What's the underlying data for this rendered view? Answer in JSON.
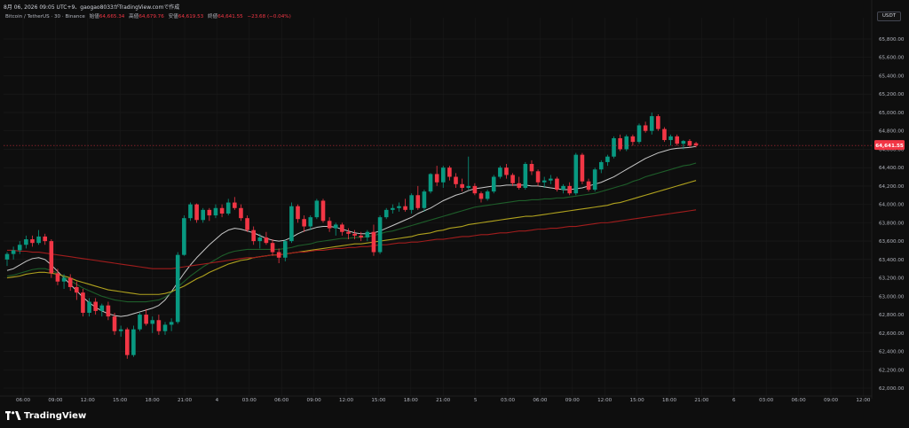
{
  "header": {
    "title": "8月 06, 2026 09:05 UTC+9、gaogao8033がTradingView.comで作成"
  },
  "legend": {
    "symbol": "Bitcoin / TetherUS · 30 · Binance",
    "open_label": "始値",
    "open_value": "64,665.34",
    "high_label": "高値",
    "high_value": "64,679.76",
    "low_label": "安値",
    "low_value": "64,619.53",
    "close_label": "終値",
    "close_value": "64,641.55",
    "change": "−23.68 (−0.04%)"
  },
  "price_axis": {
    "currency": "USDT",
    "last_price_label": "64,641.55"
  },
  "branding": {
    "name": "TradingView"
  },
  "colors": {
    "background": "#0e0e0e",
    "up": "#089981",
    "down": "#f23645",
    "ma_fast": "#c8c8c8",
    "ma_green": "#1e5e2a",
    "ma_yellow": "#b0a21e",
    "ma_red": "#a11d1d"
  },
  "chart_data": {
    "type": "candlestick",
    "interval": "30",
    "ylim": [
      62000,
      66000
    ],
    "y_ticks": [
      62000,
      62200,
      62400,
      62600,
      62800,
      63000,
      63200,
      63400,
      63600,
      63800,
      64000,
      64200,
      64400,
      64600,
      64800,
      65000,
      65200,
      65400,
      65600,
      65800
    ],
    "y_tick_labels": [
      "62,000.00",
      "62,200.00",
      "62,400.00",
      "62,600.00",
      "62,800.00",
      "63,000.00",
      "63,200.00",
      "63,400.00",
      "63,600.00",
      "63,800.00",
      "64,000.00",
      "64,200.00",
      "64,400.00",
      "64,600.00",
      "64,800.00",
      "65,000.00",
      "65,200.00",
      "65,400.00",
      "65,600.00",
      "65,800.00"
    ],
    "x_labels": [
      "06:00",
      "09:00",
      "12:00",
      "15:00",
      "18:00",
      "21:00",
      "4",
      "03:00",
      "06:00",
      "09:00",
      "12:00",
      "15:00",
      "18:00",
      "21:00",
      "5",
      "03:00",
      "06:00",
      "09:00",
      "12:00",
      "15:00",
      "18:00",
      "21:00",
      "6",
      "03:00",
      "06:00",
      "09:00",
      "12:00"
    ],
    "last_price": 64641.55,
    "candles": [
      [
        63400,
        63480,
        63330,
        63460
      ],
      [
        63460,
        63540,
        63400,
        63500
      ],
      [
        63500,
        63600,
        63460,
        63560
      ],
      [
        63560,
        63660,
        63520,
        63620
      ],
      [
        63620,
        63660,
        63540,
        63580
      ],
      [
        63580,
        63720,
        63560,
        63650
      ],
      [
        63650,
        63680,
        63560,
        63600
      ],
      [
        63600,
        63620,
        63200,
        63250
      ],
      [
        63250,
        63300,
        63120,
        63160
      ],
      [
        63160,
        63240,
        63080,
        63200
      ],
      [
        63200,
        63240,
        63060,
        63100
      ],
      [
        63100,
        63160,
        62960,
        63040
      ],
      [
        63040,
        63080,
        62780,
        62820
      ],
      [
        62820,
        62980,
        62780,
        62940
      ],
      [
        62940,
        62980,
        62800,
        62840
      ],
      [
        62840,
        62920,
        62780,
        62900
      ],
      [
        62900,
        62940,
        62740,
        62780
      ],
      [
        62780,
        62820,
        62580,
        62620
      ],
      [
        62620,
        62680,
        62560,
        62640
      ],
      [
        62640,
        62660,
        62320,
        62360
      ],
      [
        62360,
        62680,
        62340,
        62640
      ],
      [
        62640,
        62820,
        62620,
        62800
      ],
      [
        62800,
        62860,
        62680,
        62700
      ],
      [
        62700,
        62780,
        62600,
        62740
      ],
      [
        62740,
        62800,
        62580,
        62620
      ],
      [
        62620,
        62720,
        62580,
        62690
      ],
      [
        62690,
        62760,
        62620,
        62720
      ],
      [
        62720,
        63480,
        62700,
        63450
      ],
      [
        63450,
        63880,
        63440,
        63850
      ],
      [
        63850,
        64020,
        63820,
        64000
      ],
      [
        64000,
        64010,
        63800,
        63830
      ],
      [
        63830,
        63960,
        63800,
        63940
      ],
      [
        63940,
        63960,
        63820,
        63880
      ],
      [
        63880,
        64000,
        63850,
        63960
      ],
      [
        63960,
        64000,
        63860,
        63900
      ],
      [
        63900,
        64060,
        63880,
        64020
      ],
      [
        64020,
        64080,
        63940,
        63960
      ],
      [
        63960,
        64000,
        63820,
        63850
      ],
      [
        63850,
        63880,
        63700,
        63720
      ],
      [
        63720,
        63760,
        63560,
        63600
      ],
      [
        63600,
        63680,
        63520,
        63640
      ],
      [
        63640,
        63700,
        63560,
        63580
      ],
      [
        63580,
        63620,
        63440,
        63480
      ],
      [
        63480,
        63520,
        63360,
        63420
      ],
      [
        63420,
        63620,
        63380,
        63600
      ],
      [
        63600,
        64020,
        63580,
        63980
      ],
      [
        63980,
        64000,
        63800,
        63840
      ],
      [
        63840,
        63880,
        63700,
        63760
      ],
      [
        63760,
        63880,
        63720,
        63860
      ],
      [
        63860,
        64060,
        63840,
        64040
      ],
      [
        64040,
        64060,
        63800,
        63820
      ],
      [
        63820,
        63860,
        63700,
        63740
      ],
      [
        63740,
        63800,
        63660,
        63780
      ],
      [
        63780,
        63800,
        63660,
        63700
      ],
      [
        63700,
        63740,
        63620,
        63680
      ],
      [
        63680,
        63720,
        63620,
        63660
      ],
      [
        63660,
        63700,
        63600,
        63640
      ],
      [
        63640,
        63720,
        63600,
        63700
      ],
      [
        63700,
        63780,
        63440,
        63480
      ],
      [
        63480,
        63880,
        63460,
        63860
      ],
      [
        63860,
        63960,
        63840,
        63940
      ],
      [
        63940,
        64000,
        63900,
        63960
      ],
      [
        63960,
        64020,
        63920,
        63980
      ],
      [
        63980,
        64060,
        63920,
        63940
      ],
      [
        63940,
        64120,
        63900,
        64100
      ],
      [
        64100,
        64200,
        63940,
        63960
      ],
      [
        63960,
        64160,
        63920,
        64140
      ],
      [
        64140,
        64340,
        64120,
        64330
      ],
      [
        64330,
        64420,
        64200,
        64240
      ],
      [
        64240,
        64420,
        64180,
        64400
      ],
      [
        64400,
        64420,
        64260,
        64300
      ],
      [
        64300,
        64340,
        64180,
        64220
      ],
      [
        64220,
        64280,
        64140,
        64180
      ],
      [
        64180,
        64520,
        64160,
        64200
      ],
      [
        64200,
        64230,
        64100,
        64120
      ],
      [
        64120,
        64140,
        64020,
        64060
      ],
      [
        64060,
        64160,
        64040,
        64140
      ],
      [
        64140,
        64320,
        64120,
        64300
      ],
      [
        64300,
        64420,
        64280,
        64400
      ],
      [
        64400,
        64440,
        64280,
        64320
      ],
      [
        64320,
        64340,
        64200,
        64230
      ],
      [
        64230,
        64300,
        64160,
        64180
      ],
      [
        64180,
        64460,
        64160,
        64440
      ],
      [
        64440,
        64480,
        64320,
        64360
      ],
      [
        64360,
        64380,
        64200,
        64240
      ],
      [
        64240,
        64300,
        64180,
        64260
      ],
      [
        64260,
        64320,
        64220,
        64280
      ],
      [
        64280,
        64300,
        64140,
        64160
      ],
      [
        64160,
        64220,
        64120,
        64200
      ],
      [
        64200,
        64240,
        64100,
        64120
      ],
      [
        64120,
        64560,
        64100,
        64540
      ],
      [
        64540,
        64560,
        64220,
        64250
      ],
      [
        64250,
        64280,
        64140,
        64160
      ],
      [
        64160,
        64400,
        64140,
        64380
      ],
      [
        64380,
        64480,
        64340,
        64460
      ],
      [
        64460,
        64540,
        64420,
        64520
      ],
      [
        64520,
        64740,
        64500,
        64720
      ],
      [
        64720,
        64760,
        64580,
        64600
      ],
      [
        64600,
        64760,
        64580,
        64740
      ],
      [
        64740,
        64760,
        64640,
        64680
      ],
      [
        64680,
        64880,
        64660,
        64860
      ],
      [
        64860,
        64900,
        64780,
        64800
      ],
      [
        64800,
        65000,
        64760,
        64960
      ],
      [
        64960,
        64980,
        64800,
        64820
      ],
      [
        64820,
        64840,
        64680,
        64700
      ],
      [
        64700,
        64760,
        64640,
        64740
      ],
      [
        64740,
        64760,
        64640,
        64660
      ],
      [
        64660,
        64700,
        64600,
        64690
      ],
      [
        64690,
        64710,
        64620,
        64640
      ],
      [
        64665,
        64680,
        64620,
        64641
      ]
    ],
    "series": [
      {
        "color": "#c8c8c8",
        "values": [
          63280,
          63300,
          63340,
          63380,
          63410,
          63420,
          63400,
          63340,
          63270,
          63200,
          63130,
          63060,
          62990,
          62930,
          62880,
          62840,
          62810,
          62790,
          62780,
          62790,
          62810,
          62830,
          62850,
          62870,
          62900,
          62960,
          63050,
          63150,
          63250,
          63340,
          63420,
          63490,
          63560,
          63620,
          63680,
          63720,
          63740,
          63730,
          63710,
          63690,
          63660,
          63630,
          63610,
          63600,
          63610,
          63640,
          63680,
          63710,
          63730,
          63750,
          63760,
          63760,
          63750,
          63730,
          63710,
          63690,
          63680,
          63680,
          63690,
          63710,
          63740,
          63770,
          63800,
          63830,
          63860,
          63900,
          63930,
          63960,
          64000,
          64040,
          64070,
          64100,
          64120,
          64150,
          64170,
          64180,
          64190,
          64200,
          64200,
          64210,
          64210,
          64210,
          64210,
          64200,
          64200,
          64190,
          64180,
          64170,
          64160,
          64160,
          64170,
          64180,
          64200,
          64220,
          64240,
          64270,
          64300,
          64340,
          64380,
          64420,
          64460,
          64500,
          64530,
          64560,
          64580,
          64600,
          64610,
          64615,
          64620,
          64630
        ]
      },
      {
        "color": "#1e5e2a",
        "values": [
          63220,
          63230,
          63250,
          63270,
          63290,
          63300,
          63300,
          63280,
          63250,
          63210,
          63170,
          63130,
          63090,
          63060,
          63030,
          63000,
          62980,
          62960,
          62950,
          62940,
          62940,
          62940,
          62940,
          62950,
          62960,
          62990,
          63040,
          63100,
          63160,
          63220,
          63270,
          63320,
          63360,
          63400,
          63440,
          63470,
          63490,
          63500,
          63510,
          63510,
          63510,
          63510,
          63510,
          63510,
          63520,
          63530,
          63550,
          63560,
          63570,
          63590,
          63600,
          63610,
          63620,
          63630,
          63630,
          63640,
          63640,
          63650,
          63660,
          63680,
          63700,
          63710,
          63730,
          63750,
          63770,
          63790,
          63810,
          63830,
          63850,
          63870,
          63890,
          63910,
          63930,
          63950,
          63970,
          63980,
          63990,
          64000,
          64010,
          64020,
          64030,
          64040,
          64040,
          64050,
          64050,
          64060,
          64060,
          64070,
          64070,
          64080,
          64090,
          64100,
          64110,
          64120,
          64140,
          64160,
          64180,
          64200,
          64220,
          64250,
          64270,
          64300,
          64320,
          64340,
          64360,
          64380,
          64400,
          64420,
          64430,
          64450
        ]
      },
      {
        "color": "#b0a21e",
        "values": [
          63200,
          63210,
          63220,
          63240,
          63250,
          63260,
          63260,
          63250,
          63240,
          63220,
          63200,
          63170,
          63150,
          63130,
          63110,
          63090,
          63070,
          63060,
          63050,
          63040,
          63030,
          63020,
          63020,
          63020,
          63020,
          63030,
          63050,
          63080,
          63110,
          63150,
          63190,
          63220,
          63260,
          63290,
          63320,
          63350,
          63370,
          63390,
          63400,
          63420,
          63430,
          63440,
          63450,
          63450,
          63460,
          63470,
          63480,
          63490,
          63500,
          63510,
          63520,
          63530,
          63540,
          63550,
          63560,
          63570,
          63570,
          63580,
          63590,
          63600,
          63610,
          63620,
          63630,
          63640,
          63650,
          63670,
          63680,
          63690,
          63710,
          63720,
          63740,
          63750,
          63760,
          63780,
          63790,
          63800,
          63810,
          63820,
          63830,
          63840,
          63850,
          63860,
          63870,
          63870,
          63880,
          63890,
          63900,
          63910,
          63920,
          63930,
          63940,
          63950,
          63960,
          63970,
          63980,
          63990,
          64010,
          64020,
          64040,
          64060,
          64080,
          64100,
          64120,
          64140,
          64160,
          64180,
          64200,
          64220,
          64240,
          64260
        ]
      },
      {
        "color": "#a11d1d",
        "values": [
          63500,
          63500,
          63490,
          63490,
          63480,
          63480,
          63470,
          63460,
          63450,
          63440,
          63430,
          63420,
          63410,
          63400,
          63390,
          63380,
          63370,
          63360,
          63350,
          63340,
          63330,
          63320,
          63310,
          63300,
          63300,
          63300,
          63300,
          63310,
          63320,
          63330,
          63340,
          63350,
          63360,
          63370,
          63380,
          63390,
          63400,
          63410,
          63420,
          63420,
          63430,
          63440,
          63450,
          63450,
          63460,
          63470,
          63480,
          63480,
          63490,
          63500,
          63500,
          63510,
          63520,
          63520,
          63530,
          63530,
          63540,
          63540,
          63550,
          63560,
          63560,
          63570,
          63580,
          63580,
          63590,
          63590,
          63600,
          63610,
          63620,
          63620,
          63630,
          63640,
          63650,
          63650,
          63660,
          63670,
          63670,
          63680,
          63690,
          63690,
          63700,
          63710,
          63710,
          63720,
          63730,
          63730,
          63740,
          63740,
          63750,
          63760,
          63760,
          63770,
          63780,
          63790,
          63800,
          63800,
          63810,
          63820,
          63830,
          63840,
          63850,
          63860,
          63870,
          63880,
          63890,
          63900,
          63910,
          63920,
          63930,
          63940
        ]
      }
    ]
  }
}
